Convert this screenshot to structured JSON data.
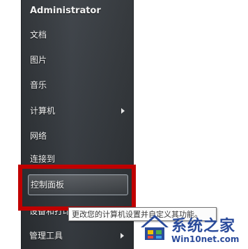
{
  "start_menu": {
    "user_name": "Administrator",
    "items": [
      {
        "label": "文档"
      },
      {
        "label": "图片"
      },
      {
        "label": "音乐"
      },
      {
        "label": "计算机"
      },
      {
        "label": "网络"
      },
      {
        "label": "连接到"
      },
      {
        "label": "控制面板"
      },
      {
        "label": "设备和打印机"
      },
      {
        "label": "管理工具"
      }
    ]
  },
  "tooltip": {
    "text": "更改您的计算机设置并自定义其功能。"
  },
  "watermark": {
    "title": "系统之家",
    "url": "Win10net.com"
  },
  "colors": {
    "highlight_box": "#c00000",
    "menu_bg": "#33373c",
    "watermark_blue": "#2a4b9b"
  }
}
